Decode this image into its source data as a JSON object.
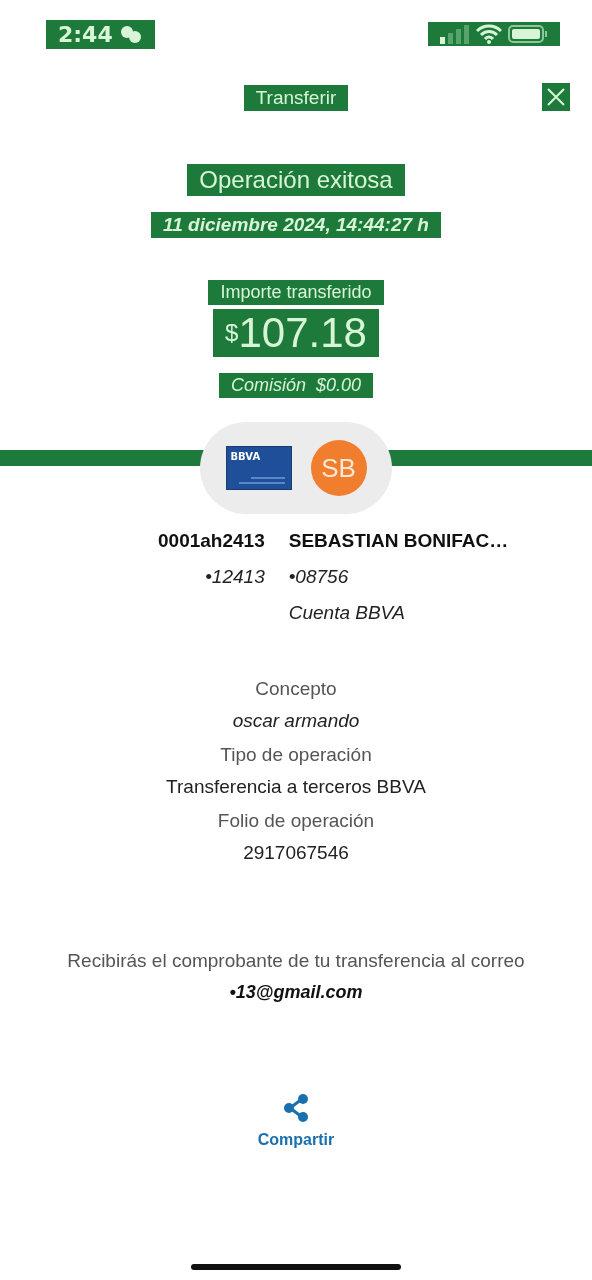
{
  "status_bar": {
    "time": "2:44"
  },
  "header": {
    "title": "Transferir"
  },
  "result": {
    "title": "Operación exitosa",
    "datetime": "11 diciembre 2024, 14:44:27 h",
    "amount_label": "Importe transferido",
    "currency": "$",
    "amount": "107.18",
    "fee_label": "Comisión",
    "fee": "$0.00"
  },
  "transfer": {
    "origin_card": "BBVA",
    "recipient_initials": "SB",
    "origin": {
      "name": "0001ah2413",
      "account": "•12413"
    },
    "recipient": {
      "name": "SEBASTIAN BONIFAC…",
      "account": "•08756",
      "bank": "Cuenta BBVA"
    }
  },
  "details": [
    {
      "label": "Concepto",
      "value": "oscar armando",
      "italic": true
    },
    {
      "label": "Tipo de operación",
      "value": "Transferencia a terceros BBVA",
      "italic": false
    },
    {
      "label": "Folio de operación",
      "value": "2917067546",
      "italic": false
    }
  ],
  "receipt": {
    "text": "Recibirás el comprobante de tu transferencia al correo",
    "email": "•13@gmail.com"
  },
  "actions": [
    {
      "label": "Compartir"
    }
  ]
}
